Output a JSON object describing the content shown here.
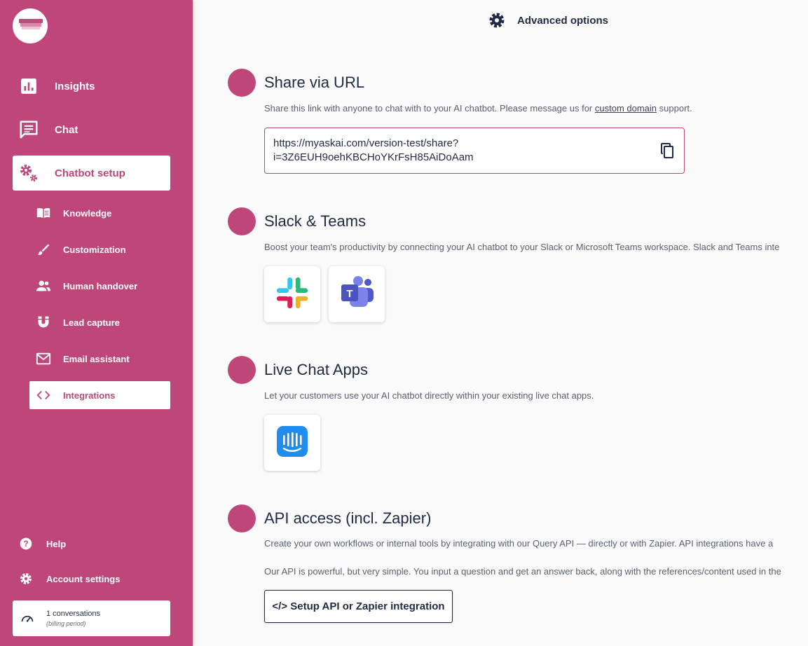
{
  "sidebar": {
    "main_items": [
      {
        "label": "Insights",
        "icon": "chart-icon"
      },
      {
        "label": "Chat",
        "icon": "chat-icon"
      },
      {
        "label": "Chatbot setup",
        "icon": "gears-icon"
      }
    ],
    "sub_items": [
      {
        "label": "Knowledge",
        "icon": "book-icon"
      },
      {
        "label": "Customization",
        "icon": "brush-icon"
      },
      {
        "label": "Human handover",
        "icon": "people-icon"
      },
      {
        "label": "Lead capture",
        "icon": "magnet-icon"
      },
      {
        "label": "Email assistant",
        "icon": "mail-icon"
      },
      {
        "label": "Integrations",
        "icon": "code-icon"
      }
    ],
    "bottom_items": [
      {
        "label": "Help",
        "icon": "help-icon"
      },
      {
        "label": "Account settings",
        "icon": "gear-icon"
      }
    ],
    "usage": {
      "count": "1 conversations",
      "period": "(billing period)"
    }
  },
  "header": {
    "advanced_options": "Advanced options"
  },
  "sections": {
    "share_url": {
      "title": "Share via URL",
      "desc_before": "Share this link with anyone to chat with to your AI chatbot. Please message us for ",
      "desc_link": "custom domain",
      "desc_after": " support.",
      "url_line1": "https://myaskai.com/version-test/share?",
      "url_line2": "i=3Z6EUH9oehKBCHoYKrFsH85AiDoAam"
    },
    "slack_teams": {
      "title": "Slack & Teams",
      "desc": "Boost your team's productivity by connecting your AI chatbot to your Slack or Microsoft Teams workspace. Slack and Teams inte"
    },
    "live_chat": {
      "title": "Live Chat Apps",
      "desc": "Let your customers use your AI chatbot directly within your existing live chat apps."
    },
    "api": {
      "title": "API access (incl. Zapier)",
      "desc1": "Create your own workflows or internal tools by integrating with our Query API — directly or with Zapier. API integrations have a",
      "desc2": "Our API is powerful, but very simple. You input a question and get an answer back, along with the references/content used in the",
      "button": "</> Setup API or Zapier integration"
    }
  },
  "colors": {
    "brand": "#be4679",
    "text": "#1f2a44"
  }
}
